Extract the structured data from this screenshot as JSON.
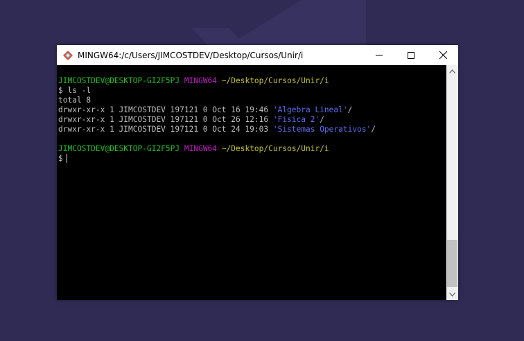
{
  "window": {
    "title": "MINGW64:/c/Users/JIMCOSTDEV/Desktop/Cursos/Unir/i"
  },
  "terminal": {
    "prompt1": {
      "user_host": "JIMCOSTDEV@DESKTOP-GI2F5PJ",
      "env": "MINGW64",
      "path": "~/Desktop/Cursos/Unir/i"
    },
    "command": "$ ls -l",
    "total": "total 8",
    "entries": [
      {
        "meta": "drwxr-xr-x 1 JIMCOSTDEV 197121 0 Oct 16 19:46 ",
        "name": "'Algebra Lineal'",
        "suffix": "/"
      },
      {
        "meta": "drwxr-xr-x 1 JIMCOSTDEV 197121 0 Oct 26 12:16 ",
        "name": "'Fisica 2'",
        "suffix": "/"
      },
      {
        "meta": "drwxr-xr-x 1 JIMCOSTDEV 197121 0 Oct 24 19:03 ",
        "name": "'Sistemas Operativos'",
        "suffix": "/"
      }
    ],
    "prompt2": {
      "user_host": "JIMCOSTDEV@DESKTOP-GI2F5PJ",
      "env": "MINGW64",
      "path": "~/Desktop/Cursos/Unir/i"
    },
    "input_prompt": "$ "
  },
  "colors": {
    "background": "#2f2b55",
    "user_host": "#1cc41c",
    "env": "#c31bc3",
    "path": "#c6c42a",
    "directory": "#5c6cf0"
  },
  "icons": {
    "app": "git-bash-diamond-icon",
    "minimize": "minimize-icon",
    "maximize": "maximize-icon",
    "close": "close-icon"
  }
}
